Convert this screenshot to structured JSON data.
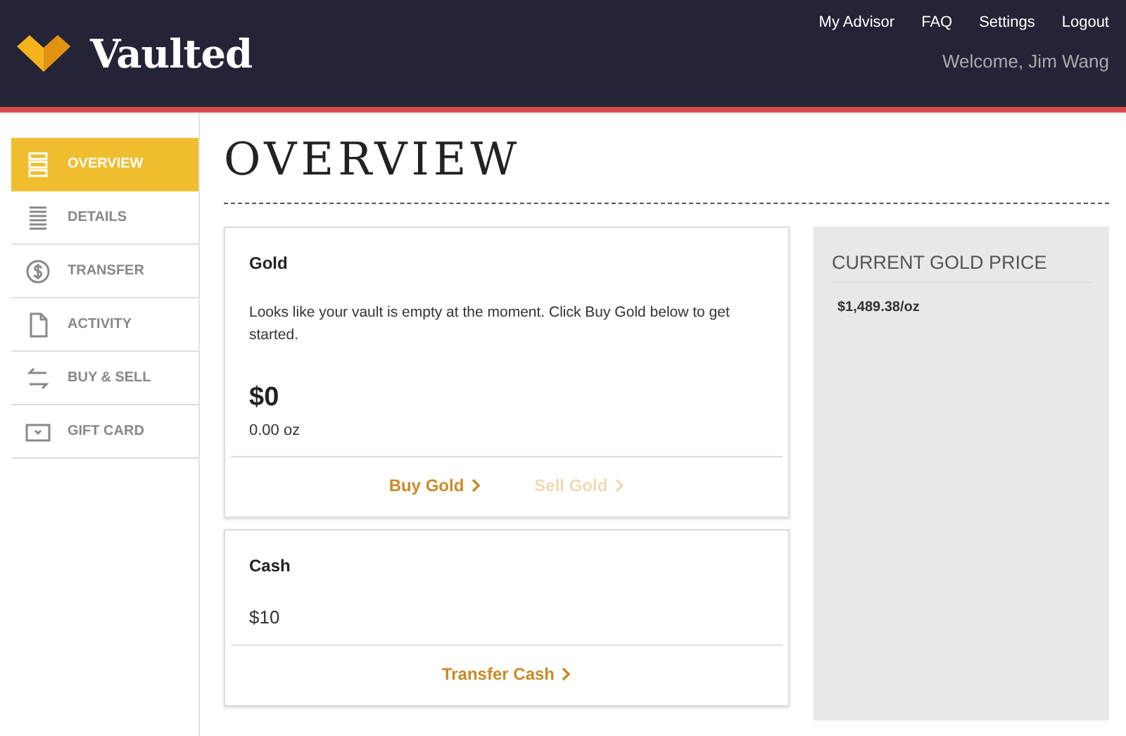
{
  "header": {
    "logo": "Vaulted",
    "nav": [
      "My Advisor",
      "FAQ",
      "Settings",
      "Logout"
    ],
    "welcome": "Welcome, Jim Wang"
  },
  "sidebar": {
    "items": [
      {
        "label": "OVERVIEW",
        "kind": "stack",
        "selected": true
      },
      {
        "label": "DETAILS",
        "kind": "lines",
        "selected": false
      },
      {
        "label": "TRANSFER",
        "kind": "dollar",
        "selected": false
      },
      {
        "label": "ACTIVITY",
        "kind": "document",
        "selected": false
      },
      {
        "label": "BUY & SELL",
        "kind": "swap",
        "selected": false
      },
      {
        "label": "GIFT CARD",
        "kind": "card",
        "selected": false
      }
    ]
  },
  "page_title": "OVERVIEW",
  "gold_card": {
    "title": "Gold",
    "message": "Looks like your vault is empty at the moment. Click Buy Gold below to get started.",
    "amount": "$0",
    "weight": "0.00 oz",
    "actions": [
      {
        "label": "Buy Gold",
        "disabled": false
      },
      {
        "label": "Sell Gold",
        "disabled": true
      }
    ]
  },
  "cash_card": {
    "title": "Cash",
    "amount": "$10",
    "actions": [
      {
        "label": "Transfer Cash",
        "disabled": false
      }
    ]
  },
  "price_panel": {
    "title": "CURRENT GOLD PRICE",
    "price": "$1,489.38/oz"
  }
}
